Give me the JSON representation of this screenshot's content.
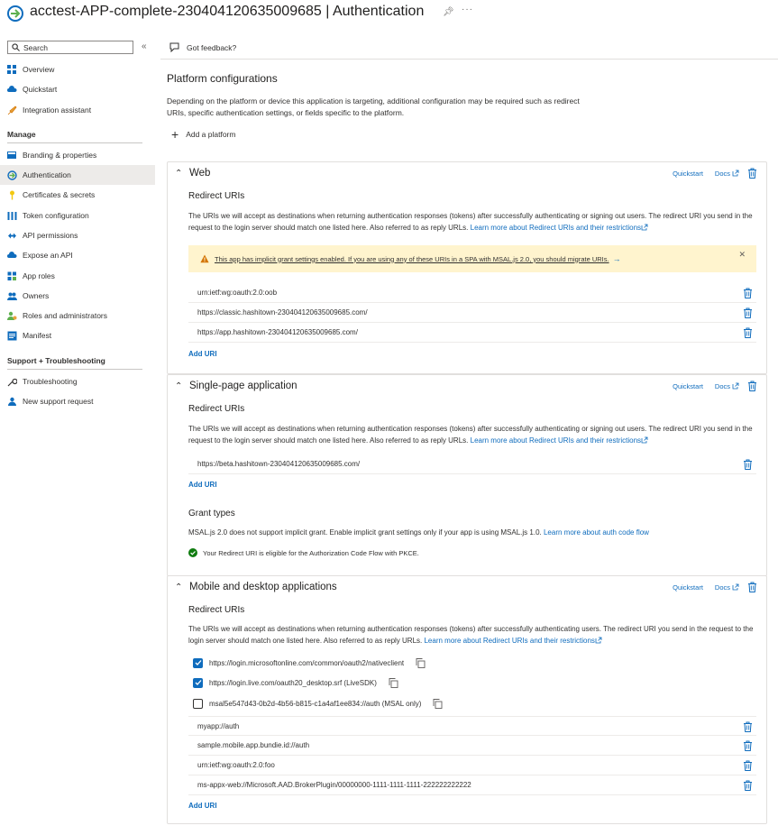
{
  "header": {
    "title": "acctest-APP-complete-230404120635009685 | Authentication",
    "more": "···"
  },
  "sidebar": {
    "search_placeholder": "Search",
    "items_top": [
      {
        "label": "Overview",
        "icon": "grid-icon"
      },
      {
        "label": "Quickstart",
        "icon": "cloud-icon"
      },
      {
        "label": "Integration assistant",
        "icon": "rocket-icon"
      }
    ],
    "manage_header": "Manage",
    "items_manage": [
      {
        "label": "Branding & properties",
        "icon": "branding-icon"
      },
      {
        "label": "Authentication",
        "icon": "authentication-icon",
        "active": true
      },
      {
        "label": "Certificates & secrets",
        "icon": "key-icon"
      },
      {
        "label": "Token configuration",
        "icon": "token-icon"
      },
      {
        "label": "API permissions",
        "icon": "api-permissions-icon"
      },
      {
        "label": "Expose an API",
        "icon": "cloud-api-icon"
      },
      {
        "label": "App roles",
        "icon": "app-roles-icon"
      },
      {
        "label": "Owners",
        "icon": "owners-icon"
      },
      {
        "label": "Roles and administrators",
        "icon": "roles-icon"
      },
      {
        "label": "Manifest",
        "icon": "manifest-icon"
      }
    ],
    "support_header": "Support + Troubleshooting",
    "items_support": [
      {
        "label": "Troubleshooting",
        "icon": "wrench-icon"
      },
      {
        "label": "New support request",
        "icon": "person-support-icon"
      }
    ]
  },
  "toolbar": {
    "feedback": "Got feedback?"
  },
  "main": {
    "title": "Platform configurations",
    "intro": "Depending on the platform or device this application is targeting, additional configuration may be required such as redirect URIs, specific authentication settings, or fields specific to the platform.",
    "add_platform": "Add a platform",
    "quickstart": "Quickstart",
    "docs": "Docs",
    "redirect_uris": "Redirect URIs",
    "add_uri": "Add URI",
    "learn_more_redirect": "Learn more about Redirect URIs and their restrictions",
    "web": {
      "title": "Web",
      "desc": "The URIs we will accept as destinations when returning authentication responses (tokens) after successfully authenticating or signing out users. The redirect URI you send in the request to the login server should match one listed here. Also referred to as reply URLs.",
      "warning": "This app has implicit grant settings enabled. If you are using any of these URIs in a SPA with MSAL.js 2.0, you should migrate URIs.",
      "uris": [
        "urn:ietf:wg:oauth:2.0:oob",
        "https://classic.hashitown-230404120635009685.com/",
        "https://app.hashitown-230404120635009685.com/"
      ]
    },
    "spa": {
      "title": "Single-page application",
      "desc": "The URIs we will accept as destinations when returning authentication responses (tokens) after successfully authenticating or signing out users. The redirect URI you send in the request to the login server should match one listed here. Also referred to as reply URLs.",
      "uris": [
        "https://beta.hashitown-230404120635009685.com/"
      ],
      "grant_title": "Grant types",
      "grant_desc": "MSAL.js 2.0 does not support implicit grant. Enable implicit grant settings only if your app is using MSAL.js 1.0.",
      "grant_link": "Learn more about auth code flow",
      "pkce_ok": "Your Redirect URI is eligible for the Authorization Code Flow with PKCE."
    },
    "mobile": {
      "title": "Mobile and desktop applications",
      "desc": "The URIs we will accept as destinations when returning authentication responses (tokens) after successfully authenticating users. The redirect URI you send in the request to the login server should match one listed here. Also referred to as reply URLs.",
      "suggested": [
        {
          "uri": "https://login.microsoftonline.com/common/oauth2/nativeclient",
          "checked": true
        },
        {
          "uri": "https://login.live.com/oauth20_desktop.srf (LiveSDK)",
          "checked": true
        },
        {
          "uri": "msal5e547d43-0b2d-4b56-b815-c1a4af1ee834://auth (MSAL only)",
          "checked": false
        }
      ],
      "uris": [
        "myapp://auth",
        "sample.mobile.app.bundie.id://auth",
        "urn:ietf:wg:oauth:2.0:foo",
        "ms-appx-web://Microsoft.AAD.BrokerPlugin/00000000-1111-1111-1111-222222222222"
      ]
    }
  },
  "colors": {
    "accent": "#0f6cbd",
    "warning_bg": "#fff4ce",
    "active_nav": "#edebe9",
    "success": "#107c10"
  }
}
